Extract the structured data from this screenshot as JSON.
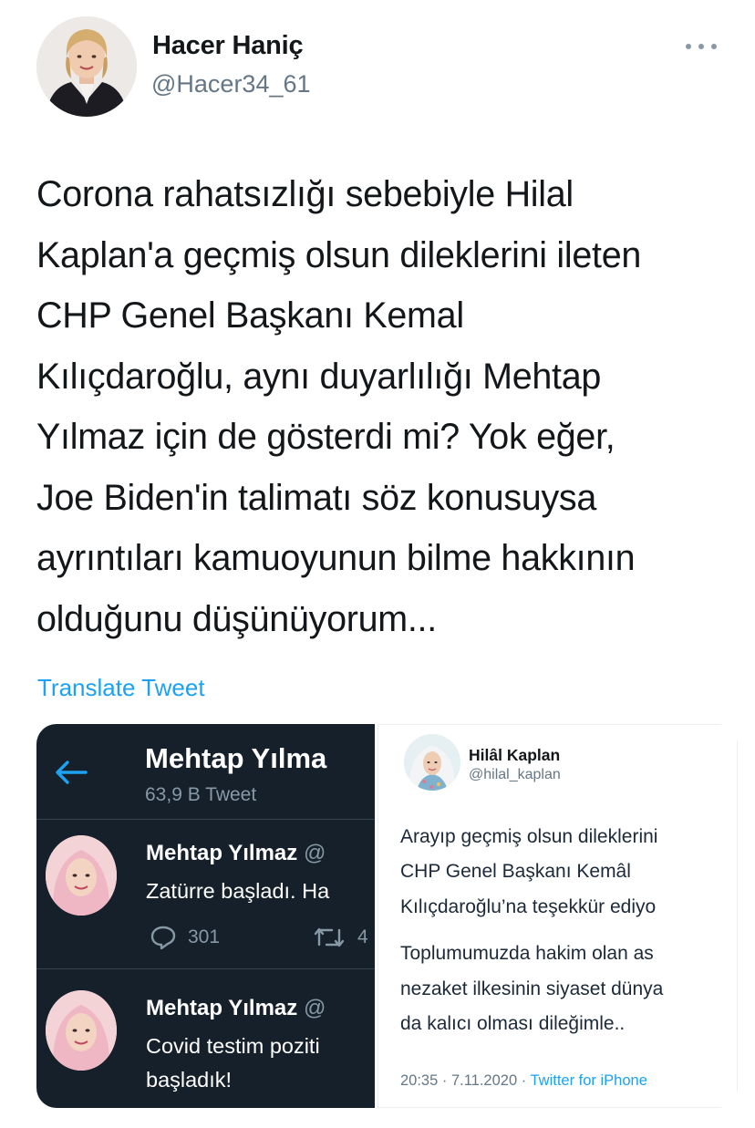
{
  "author": {
    "name": "Hacer Haniç",
    "handle": "@Hacer34_61"
  },
  "more_icon": "more-dots-icon",
  "tweet": {
    "lines": [
      "Corona rahatsızlığı sebebiyle Hilal",
      "Kaplan'a geçmiş olsun dileklerini ileten",
      "CHP Genel Başkanı Kemal",
      "Kılıçdaroğlu, aynı duyarlılığı Mehtap",
      "Yılmaz için de gösterdi mi? Yok eğer,",
      "Joe Biden'in talimatı söz konusuysa",
      "ayrıntıları kamuoyunun bilme hakkının",
      "olduğunu düşünüyorum..."
    ]
  },
  "translate_label": "Translate Tweet",
  "colors": {
    "link": "#1da1f2",
    "dark_bg": "#15202b",
    "muted": "#657786"
  },
  "media": {
    "left": {
      "title": "Mehtap Yılma",
      "tweet_count": "63,9 B Tweet",
      "tweets": [
        {
          "name": "Mehtap Yılmaz",
          "at": "@",
          "lines": [
            "Zatürre başladı. Ha"
          ],
          "reply_count": "301",
          "retweet_count": "4"
        },
        {
          "name": "Mehtap Yılmaz",
          "at": "@",
          "lines": [
            "Covid testim poziti",
            "başladık!"
          ]
        }
      ]
    },
    "right": {
      "name": "Hilâl Kaplan",
      "handle": "@hilal_kaplan",
      "paragraph1": [
        "Arayıp geçmiş olsun dileklerini",
        "CHP Genel Başkanı Kemâl",
        "Kılıçdaroğlu’na teşekkür ediyo"
      ],
      "paragraph2": [
        "Toplumumuzda hakim olan as",
        "nezaket ilkesinin siyaset dünya",
        "da kalıcı olması dileğimle.."
      ],
      "timestamp": "20:35 · 7.11.2020 · ",
      "source": "Twitter for iPhone"
    }
  }
}
